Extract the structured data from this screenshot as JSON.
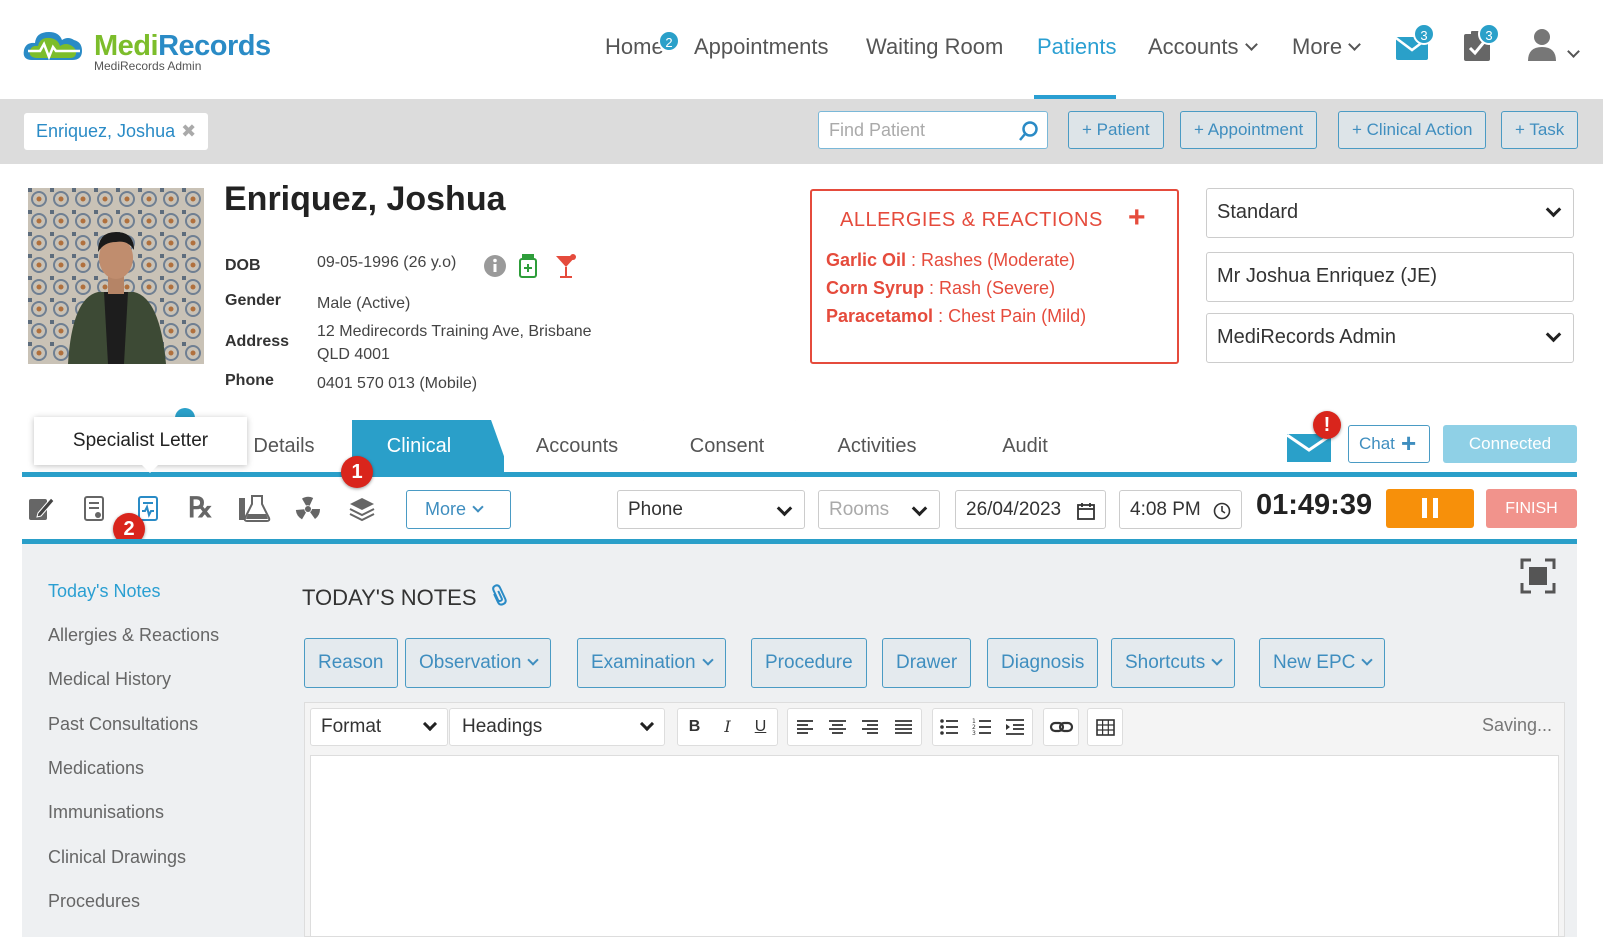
{
  "app": {
    "name_part1": "Medi",
    "name_part2": "Records",
    "subtitle": "MediRecords Admin"
  },
  "nav": {
    "home": "Home",
    "home_badge": "2",
    "appointments": "Appointments",
    "waiting_room": "Waiting Room",
    "patients": "Patients",
    "accounts": "Accounts",
    "more": "More",
    "mail_badge": "3",
    "tasks_badge": "3"
  },
  "bar": {
    "patient_tab": "Enriquez, Joshua",
    "find_placeholder": "Find Patient",
    "add_patient": "+ Patient",
    "add_appointment": "+ Appointment",
    "add_clinical_action": "+ Clinical Action",
    "add_task": "+ Task"
  },
  "patient": {
    "name": "Enriquez, Joshua",
    "dob_label": "DOB",
    "dob": "09-05-1996 (26 y.o)",
    "gender_label": "Gender",
    "gender": "Male (Active)",
    "address_label": "Address",
    "address_line1": "12 Medirecords Training Ave, Brisbane",
    "address_line2": "QLD 4001",
    "phone_label": "Phone",
    "phone": "0401 570 013 (Mobile)"
  },
  "allergies": {
    "title": "ALLERGIES & REACTIONS",
    "items": [
      {
        "name": "Garlic Oil",
        "reaction": " : Rashes (Moderate)"
      },
      {
        "name": "Corn Syrup",
        "reaction": " : Rash (Severe)"
      },
      {
        "name": "Paracetamol",
        "reaction": " : Chest Pain (Mild)"
      }
    ]
  },
  "selectors": {
    "billing": "Standard",
    "practitioner": "Mr Joshua Enriquez (JE)",
    "location": "MediRecords Admin"
  },
  "tabs": [
    "Details",
    "Clinical",
    "Accounts",
    "Consent",
    "Activities",
    "Audit"
  ],
  "tooltip": "Specialist Letter",
  "badges": {
    "one": "1",
    "two": "2",
    "alert": "!"
  },
  "chat": "Chat",
  "connected": "Connected",
  "toolbar": {
    "more": "More",
    "mode": "Phone",
    "rooms": "Rooms",
    "date": "26/04/2023",
    "time": "4:08 PM",
    "timer": "01:49:39",
    "finish": "FINISH"
  },
  "sidebar": [
    "Today's Notes",
    "Allergies & Reactions",
    "Medical History",
    "Past Consultations",
    "Medications",
    "Immunisations",
    "Clinical Drawings",
    "Procedures"
  ],
  "notes": {
    "title": "TODAY'S NOTES",
    "buttons": [
      "Reason",
      "Observation",
      "Examination",
      "Procedure",
      "Drawer",
      "Diagnosis",
      "Shortcuts",
      "New EPC"
    ],
    "format": "Format",
    "headings": "Headings",
    "saving": "Saving..."
  },
  "colors": {
    "accent": "#2a9fc9",
    "allergy": "#e54b3c",
    "pause": "#f7900a",
    "finish": "#f1938c"
  }
}
